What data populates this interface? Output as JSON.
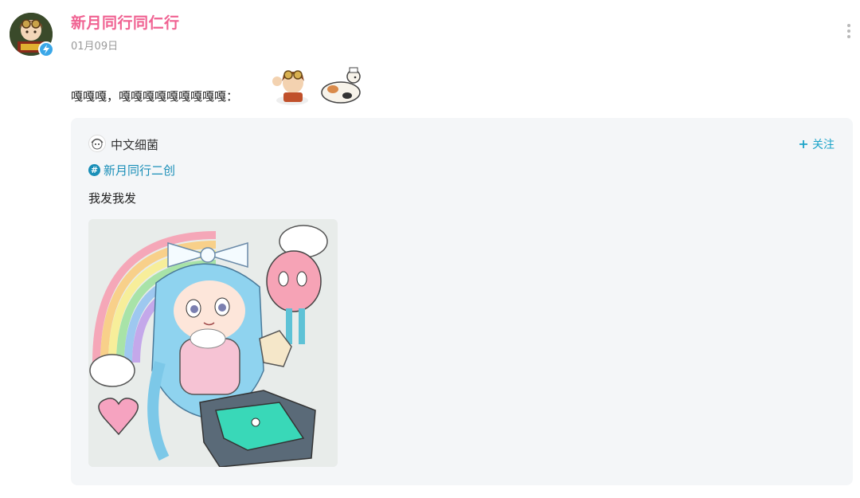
{
  "author": {
    "name": "新月同行同仁行",
    "date": "01月09日",
    "avatar_icon": "avatar-character-icon",
    "verified_icon": "verified-bolt-icon"
  },
  "post": {
    "text": "嘎嘎嘎，嘎嘎嘎嘎嘎嘎嘎嘎嘎："
  },
  "quoted_post": {
    "username": "中文细菌",
    "follow_label": "关注",
    "topic": "新月同行二创",
    "text": "我发我发"
  },
  "colors": {
    "author_name": "#f06292",
    "accent": "#1aa3c8",
    "card_bg": "#f4f6f8"
  }
}
